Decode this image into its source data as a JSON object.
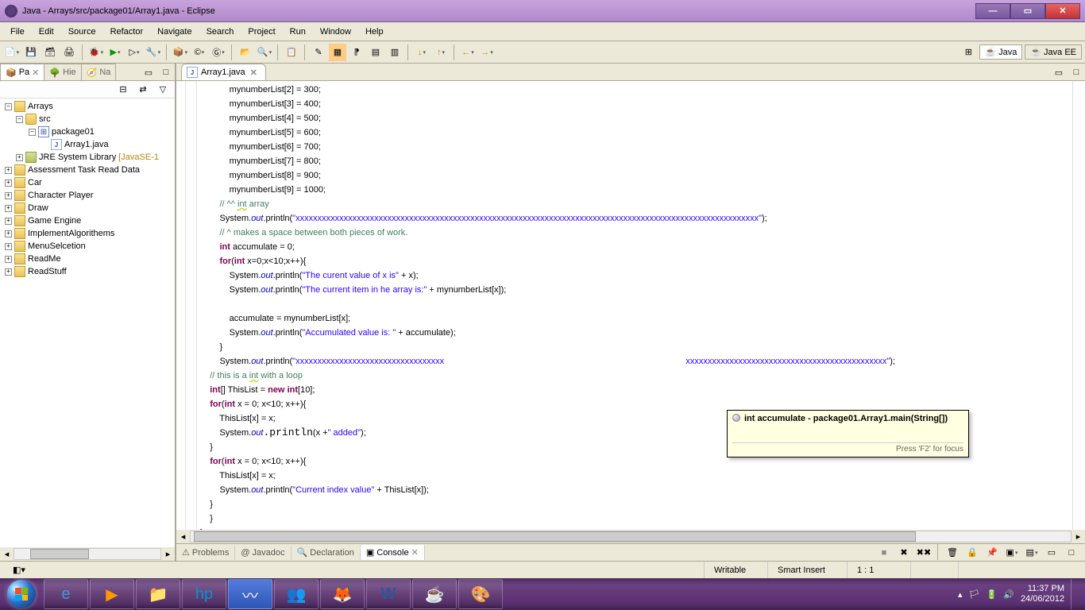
{
  "window": {
    "title": "Java - Arrays/src/package01/Array1.java - Eclipse"
  },
  "menu": [
    "File",
    "Edit",
    "Source",
    "Refactor",
    "Navigate",
    "Search",
    "Project",
    "Run",
    "Window",
    "Help"
  ],
  "perspectives": {
    "java": "Java",
    "jee": "Java EE"
  },
  "left_tabs": {
    "pa": "Pa",
    "hie": "Hie",
    "na": "Na"
  },
  "projects": {
    "arrays": "Arrays",
    "src": "src",
    "pkg": "package01",
    "file": "Array1.java",
    "jre": "JRE System Library",
    "jre_suffix": "[JavaSE-1",
    "others": [
      "Assessment Task Read Data",
      "Car",
      "Character Player",
      "Draw",
      "Game Engine",
      "ImplementAlgorithems",
      "MenuSelcetion",
      "ReadMe",
      "ReadStuff"
    ]
  },
  "editor_tab": "Array1.java",
  "code": {
    "l0": "            mynumberList[2] = 300;",
    "l1": "            mynumberList[3] = 400;",
    "l2": "            mynumberList[4] = 500;",
    "l3": "            mynumberList[5] = 600;",
    "l4": "            mynumberList[6] = 700;",
    "l5": "            mynumberList[7] = 800;",
    "l6": "            mynumberList[8] = 900;",
    "l7": "            mynumberList[9] = 1000;",
    "c8a": "        // ^^ ",
    "c8kw": "int",
    "c8b": " array",
    "p_sys": "        System.",
    "p_out": "out",
    "p_println": ".println(",
    "xxx": "\"xxxxxxxxxxxxxxxxxxxxxxxxxxxxxxxxxxxxxxxxxxxxxxxxxxxxxxxxxxxxxxxxxxxxxxxxxxxxxxxxxxxxxxxxxxxxxxxxxxxxxxxxxx\"",
    "p_end": ");",
    "c10": "        // ^ makes a space between both pieces of work.",
    "l11a": "        ",
    "l11kw": "int",
    "l11b": " accumulate = 0;",
    "l12a": "        ",
    "l12kw": "for",
    "l12b": "(",
    "l12kw2": "int",
    "l12c": " x=0;x<10;x++){",
    "s13": "            System.",
    "str13": "\"The curent value of x is\"",
    "end13": " + x);",
    "s14": "            System.",
    "str14": "\"The current item in he array is:\"",
    "end14": " + mynumberList[x]);",
    "blank": "",
    "l16": "            accumulate = mynumberList[x];",
    "s17": "            System.",
    "str17": "\"Accumulated value is: \"",
    "end17": " + accumulate);",
    "l18": "        }",
    "s19": "        System.",
    "xxx2": "\"xxxxxxxxxxxxxxxxxxxxxxxxxxxxxxxxxx",
    "xxx2b": "xxxxxxxxxxxxxxxxxxxxxxxxxxxxxxxxxxxxxxxxxxxxxx\"",
    "c20a": "    // this is a ",
    "c20kw": "int",
    "c20b": " with a loop",
    "l21a": "    ",
    "l21kw": "int",
    "l21b": "[] ThisList = ",
    "l21kw2": "new",
    "l21c": " ",
    "l21kw3": "int",
    "l21d": "[10];",
    "l22a": "    ",
    "l22kw": "for",
    "l22b": "(",
    "l22kw2": "int",
    "l22c": " x = 0; x<10; x++){",
    "l23": "        ThisList[x] = x;",
    "s24": "        System.",
    "end24": "(x +",
    "str24": "\" added\"",
    "end24b": ");",
    "l25": "    }",
    "l26a": "    ",
    "l26kw": "for",
    "l26b": "(",
    "l26kw2": "int",
    "l26c": " x = 0; x<10; x++){",
    "l27": "        ThisList[x] = x;",
    "s28": "        System.",
    "str28": "\"Current index value\"",
    "end28": " + ThisList[x]);",
    "l29": "    }",
    "l30": "    }",
    "l31": "}"
  },
  "tooltip": {
    "text": "int accumulate - package01.Array1.main(String[])",
    "footer": "Press 'F2' for focus"
  },
  "bottom_tabs": {
    "problems": "Problems",
    "javadoc": "Javadoc",
    "decl": "Declaration",
    "console": "Console"
  },
  "status": {
    "writable": "Writable",
    "insert": "Smart Insert",
    "pos": "1 : 1"
  },
  "tray": {
    "time": "11:37 PM",
    "date": "24/06/2012"
  }
}
